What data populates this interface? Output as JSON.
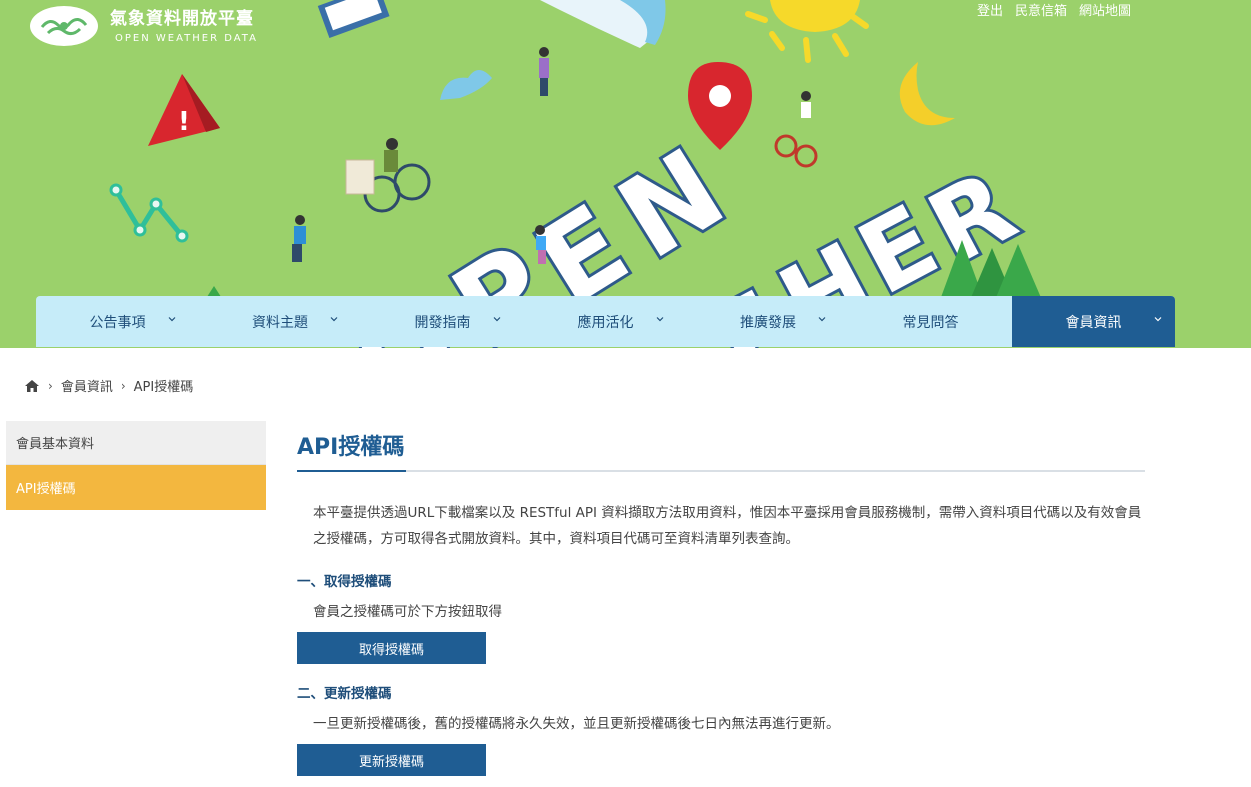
{
  "logo": {
    "title": "氣象資料開放平臺",
    "subtitle": "OPEN WEATHER DATA"
  },
  "top_links": [
    "登出",
    "民意信箱",
    "網站地圖"
  ],
  "nav": [
    {
      "label": "公告事項",
      "has_dropdown": true
    },
    {
      "label": "資料主題",
      "has_dropdown": true
    },
    {
      "label": "開發指南",
      "has_dropdown": true
    },
    {
      "label": "應用活化",
      "has_dropdown": true
    },
    {
      "label": "推廣發展",
      "has_dropdown": true
    },
    {
      "label": "常見問答",
      "has_dropdown": false
    },
    {
      "label": "會員資訊",
      "has_dropdown": true,
      "active": true
    }
  ],
  "breadcrumb": [
    "會員資訊",
    "API授權碼"
  ],
  "sidebar": {
    "items": [
      {
        "label": "會員基本資料",
        "active": false
      },
      {
        "label": "API授權碼",
        "active": true
      }
    ]
  },
  "main": {
    "title": "API授權碼",
    "intro": "本平臺提供透過URL下載檔案以及 RESTful API 資料擷取方法取用資料，惟因本平臺採用會員服務機制，需帶入資料項目代碼以及有效會員之授權碼，方可取得各式開放資料。其中，資料項目代碼可至資料清單列表查詢。",
    "sections": [
      {
        "title": "一、取得授權碼",
        "text": "會員之授權碼可於下方按鈕取得",
        "button": "取得授權碼"
      },
      {
        "title": "二、更新授權碼",
        "text": "一旦更新授權碼後，舊的授權碼將永久失效，並且更新授權碼後七日內無法再進行更新。",
        "button": "更新授權碼"
      }
    ]
  },
  "colors": {
    "banner_green": "#9bd16b",
    "nav_bg": "#c6ecf9",
    "nav_active": "#1f5d93",
    "sidebar_active": "#f3b73f",
    "primary_button": "#1f5d93"
  }
}
